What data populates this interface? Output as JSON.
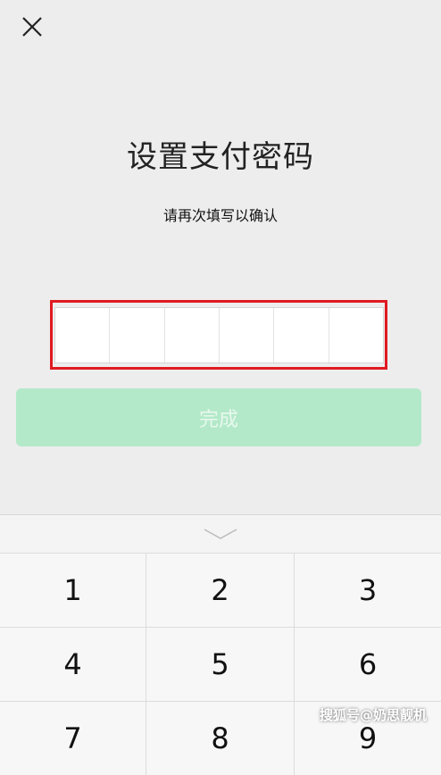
{
  "header": {
    "close_icon": "close-icon"
  },
  "main": {
    "title": "设置支付密码",
    "subtitle": "请再次填写以确认",
    "pin_length": 6,
    "done_label": "完成",
    "done_button_color": "#b3e9c9"
  },
  "keyboard": {
    "collapse_icon": "chevron-down-icon",
    "keys": [
      "1",
      "2",
      "3",
      "4",
      "5",
      "6",
      "7",
      "8",
      "9"
    ]
  },
  "watermark": "搜狐号@奶思靓机",
  "colors": {
    "highlight": "#e01a22",
    "background": "#ededed"
  }
}
